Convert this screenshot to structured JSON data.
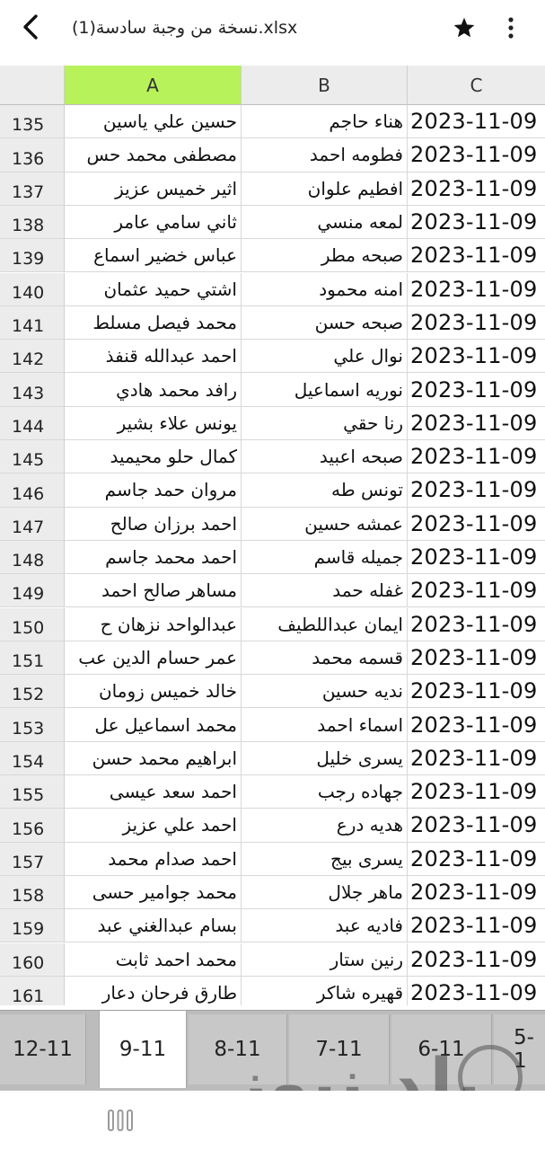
{
  "header": {
    "title": "نسخة من وجبة سادسة(1).xlsx",
    "back_icon": "chevron-left-icon",
    "star_icon": "star-icon",
    "more_icon": "more-vertical-icon"
  },
  "sheet": {
    "corner": "",
    "columns": [
      "A",
      "B",
      "C"
    ],
    "selected_column": "A",
    "selected_column_color": "#b7f25a",
    "rows": [
      {
        "num": "135",
        "a": "حسين علي ياسين",
        "b": "هناء حاجم",
        "c": "2023-11-09"
      },
      {
        "num": "136",
        "a": "مصطفى محمد حس",
        "b": "فطومه احمد",
        "c": "2023-11-09"
      },
      {
        "num": "137",
        "a": "اثير خميس عزيز",
        "b": "افطيم علوان",
        "c": "2023-11-09"
      },
      {
        "num": "138",
        "a": "ثاني سامي عامر",
        "b": "لمعه منسي",
        "c": "2023-11-09"
      },
      {
        "num": "139",
        "a": "عباس خضير اسماع",
        "b": "صبحه مطر",
        "c": "2023-11-09"
      },
      {
        "num": "140",
        "a": "اشتي حميد عثمان",
        "b": "امنه محمود",
        "c": "2023-11-09"
      },
      {
        "num": "141",
        "a": "محمد فيصل مسلط",
        "b": "صبحه حسن",
        "c": "2023-11-09"
      },
      {
        "num": "142",
        "a": "احمد عبدالله قنفذ",
        "b": "نوال علي",
        "c": "2023-11-09"
      },
      {
        "num": "143",
        "a": "رافد محمد هادي",
        "b": "نوريه اسماعيل",
        "c": "2023-11-09"
      },
      {
        "num": "144",
        "a": "يونس علاء بشير",
        "b": "رنا حقي",
        "c": "2023-11-09"
      },
      {
        "num": "145",
        "a": "كمال حلو محيميد",
        "b": "صبحه اعبيد",
        "c": "2023-11-09"
      },
      {
        "num": "146",
        "a": "مروان حمد جاسم",
        "b": "تونس طه",
        "c": "2023-11-09"
      },
      {
        "num": "147",
        "a": "احمد برزان صالح",
        "b": "عمشه حسين",
        "c": "2023-11-09"
      },
      {
        "num": "148",
        "a": "احمد محمد جاسم",
        "b": "جميله قاسم",
        "c": "2023-11-09"
      },
      {
        "num": "149",
        "a": "مساهر صالح احمد",
        "b": "غفله حمد",
        "c": "2023-11-09"
      },
      {
        "num": "150",
        "a": "عبدالواحد نزهان ح",
        "b": "ايمان عبداللطيف",
        "c": "2023-11-09"
      },
      {
        "num": "151",
        "a": "عمر حسام الدين عب",
        "b": "قسمه محمد",
        "c": "2023-11-09"
      },
      {
        "num": "152",
        "a": "خالد خميس زومان",
        "b": "نديه حسين",
        "c": "2023-11-09"
      },
      {
        "num": "153",
        "a": "محمد اسماعيل عل",
        "b": "اسماء احمد",
        "c": "2023-11-09"
      },
      {
        "num": "154",
        "a": "ابراهيم محمد حسن",
        "b": "يسرى خليل",
        "c": "2023-11-09"
      },
      {
        "num": "155",
        "a": "احمد سعد عيسى",
        "b": "جهاده رجب",
        "c": "2023-11-09"
      },
      {
        "num": "156",
        "a": "احمد علي عزيز",
        "b": "هديه درع",
        "c": "2023-11-09"
      },
      {
        "num": "157",
        "a": "احمد صدام محمد",
        "b": "يسرى بيج",
        "c": "2023-11-09"
      },
      {
        "num": "158",
        "a": "محمد جوامير حسى",
        "b": "ماهر جلال",
        "c": "2023-11-09"
      },
      {
        "num": "159",
        "a": "بسام عبدالغني عبد",
        "b": "فاديه عبد",
        "c": "2023-11-09"
      },
      {
        "num": "160",
        "a": "محمد احمد ثابت",
        "b": "رنين ستار",
        "c": "2023-11-09"
      },
      {
        "num": "161",
        "a": "طارق فرحان دعار",
        "b": "قهيره شاكر",
        "c": "2023-11-09"
      }
    ]
  },
  "tabs": {
    "items": [
      "12-11",
      "9-11",
      "8-11",
      "7-11",
      "6-11",
      "5-1"
    ],
    "active": "9-11"
  },
  "watermark": {
    "text": "بلد نيوز"
  },
  "navbar": {
    "recents_icon": "recents-icon"
  }
}
